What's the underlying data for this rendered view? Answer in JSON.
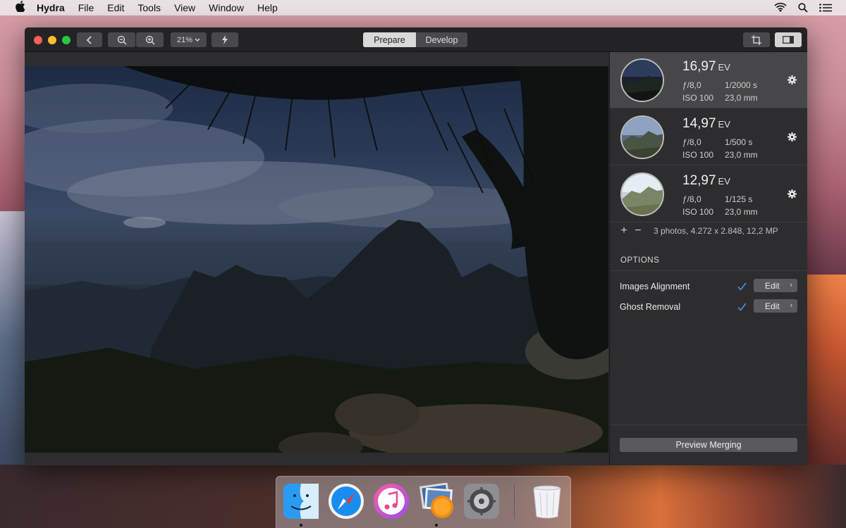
{
  "menubar": {
    "app_name": "Hydra",
    "items": [
      "File",
      "Edit",
      "Tools",
      "View",
      "Window",
      "Help"
    ],
    "icons": [
      "wifi-icon",
      "spotlight-search-icon",
      "notification-center-icon"
    ]
  },
  "toolbar": {
    "zoom_level": "21%",
    "modes": [
      "Prepare",
      "Develop"
    ],
    "active_mode": "Prepare"
  },
  "exposures": [
    {
      "ev": "16,97",
      "ev_unit": "EV",
      "aperture": "ƒ/8,0",
      "shutter": "1/2000 s",
      "iso": "ISO 100",
      "focal": "23,0 mm",
      "selected": true
    },
    {
      "ev": "14,97",
      "ev_unit": "EV",
      "aperture": "ƒ/8,0",
      "shutter": "1/500 s",
      "iso": "ISO 100",
      "focal": "23,0 mm",
      "selected": false
    },
    {
      "ev": "12,97",
      "ev_unit": "EV",
      "aperture": "ƒ/8,0",
      "shutter": "1/125 s",
      "iso": "ISO 100",
      "focal": "23,0 mm",
      "selected": false
    }
  ],
  "summary": {
    "add_label": "+",
    "remove_label": "−",
    "text": "3 photos, 4.272 x 2.848, 12,2 MP"
  },
  "options": {
    "header": "OPTIONS",
    "items": [
      {
        "label": "Images Alignment",
        "checked": true,
        "edit_label": "Edit",
        "chevron": "›"
      },
      {
        "label": "Ghost Removal",
        "checked": true,
        "edit_label": "Edit",
        "chevron": "›"
      }
    ]
  },
  "preview_button": "Preview Merging",
  "colors": {
    "accent_check": "#4a90e2",
    "window_bg": "#2b2b2d",
    "selected_row": "#474749"
  },
  "dock": {
    "apps": [
      "finder-icon",
      "safari-icon",
      "itunes-icon",
      "hydra-app-icon",
      "system-preferences-icon",
      "trash-icon"
    ]
  }
}
